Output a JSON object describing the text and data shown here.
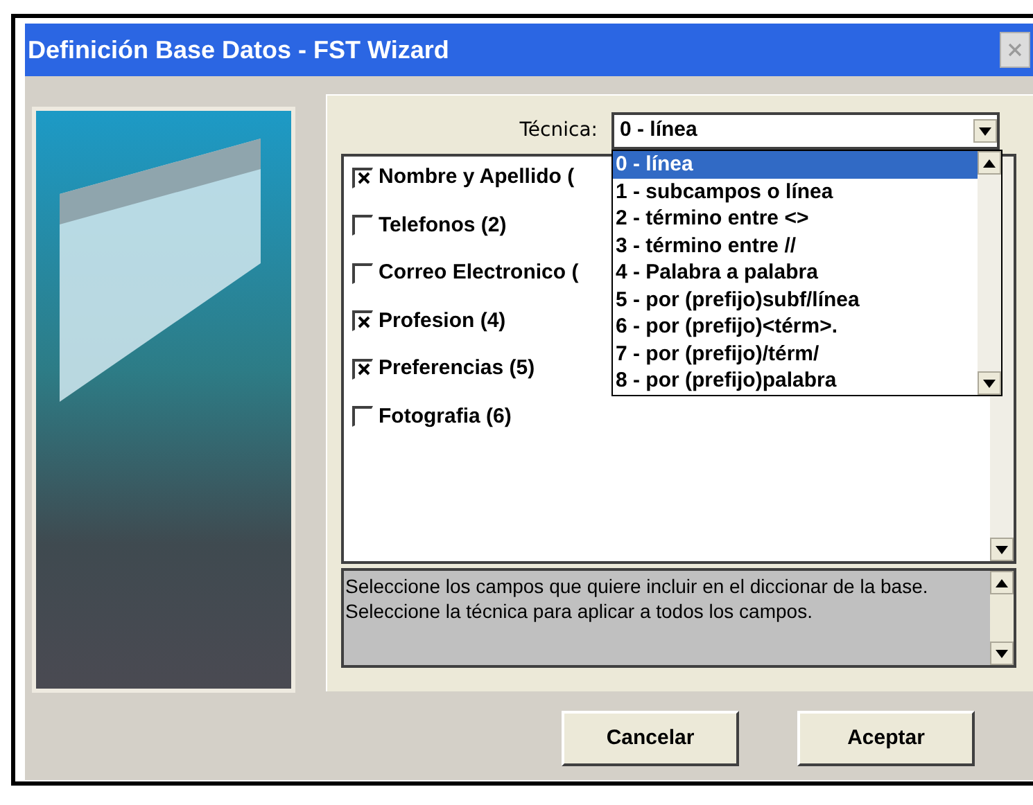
{
  "window": {
    "title": "Definición Base Datos - FST Wizard"
  },
  "technique": {
    "label": "Técnica:",
    "value": "0 - línea",
    "expanded": true,
    "options": [
      {
        "label": "0 - línea",
        "selected": true
      },
      {
        "label": "1 - subcampos o línea",
        "selected": false
      },
      {
        "label": "2 - término entre <>",
        "selected": false
      },
      {
        "label": "3 - término entre //",
        "selected": false
      },
      {
        "label": "4 - Palabra a palabra",
        "selected": false
      },
      {
        "label": "5 - por (prefijo)subf/línea",
        "selected": false
      },
      {
        "label": "6 - por (prefijo)<térm>.",
        "selected": false
      },
      {
        "label": "7 - por (prefijo)/térm/",
        "selected": false
      },
      {
        "label": "8 - por (prefijo)palabra",
        "selected": false
      }
    ]
  },
  "fields": [
    {
      "label": "Nombre y Apellido (",
      "checked": true
    },
    {
      "label": "Telefonos (2)",
      "checked": false
    },
    {
      "label": "Correo Electronico (",
      "checked": false
    },
    {
      "label": "Profesion (4)",
      "checked": true
    },
    {
      "label": "Preferencias (5)",
      "checked": true
    },
    {
      "label": "Fotografia (6)",
      "checked": false
    }
  ],
  "help_text": "Seleccione los campos que quiere incluir en el diccionar de la base. Seleccione la técnica para aplicar a todos los campos.",
  "buttons": [
    {
      "label": "Cancelar"
    },
    {
      "label": "Aceptar"
    }
  ]
}
